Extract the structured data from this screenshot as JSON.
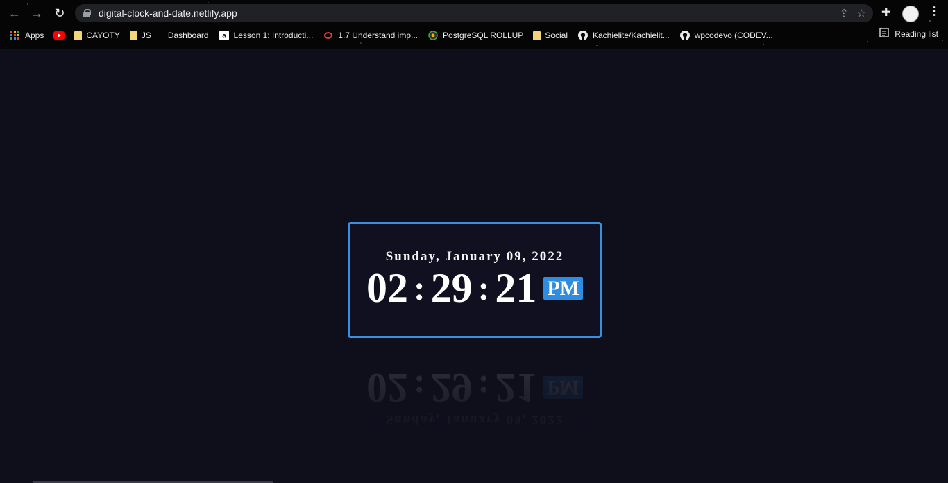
{
  "browser": {
    "url": "digital-clock-and-date.netlify.app",
    "bookmarks": [
      {
        "label": "Apps",
        "icon": "apps-grid-icon"
      },
      {
        "label": "",
        "icon": "youtube-icon"
      },
      {
        "label": "CAYOTY",
        "icon": "folder-icon"
      },
      {
        "label": "JS",
        "icon": "folder-icon"
      },
      {
        "label": "Dashboard",
        "icon": "page-icon"
      },
      {
        "label": "Lesson 1: Introducti...",
        "icon": "amazon-icon"
      },
      {
        "label": "1.7 Understand imp...",
        "icon": "oracle-icon"
      },
      {
        "label": "PostgreSQL ROLLUP",
        "icon": "postgres-icon"
      },
      {
        "label": "Social",
        "icon": "folder-icon"
      },
      {
        "label": "Kachielite/Kachielit...",
        "icon": "github-icon"
      },
      {
        "label": "wpcodevo (CODEV...",
        "icon": "github-icon"
      }
    ],
    "reading_list": "Reading list"
  },
  "clock": {
    "date": "Sunday, January 09, 2022",
    "hours": "02",
    "minutes": "29",
    "seconds": "21",
    "colon": ":",
    "period": "PM"
  },
  "colors": {
    "page_bg": "#0f0f1c",
    "accent": "#2e8de0",
    "border": "#3c8ee0"
  }
}
